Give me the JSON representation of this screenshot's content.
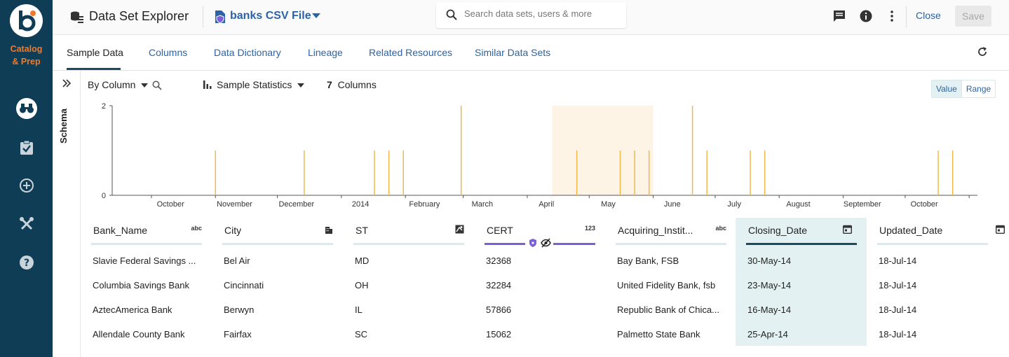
{
  "brand": {
    "logo_letter": "b",
    "product_line1": "Catalog",
    "product_line2": "& Prep",
    "accent": "#f07a2c",
    "sidebar_bg": "#0f3d56"
  },
  "sidebar": {
    "items": [
      {
        "icon": "binoculars-icon",
        "active": true
      },
      {
        "icon": "clipboard-check-icon"
      },
      {
        "icon": "add-circle-icon"
      },
      {
        "icon": "tools-icon"
      },
      {
        "icon": "help-icon"
      }
    ]
  },
  "header": {
    "title": "Data Set Explorer",
    "file_name": "banks CSV File",
    "search_placeholder": "Search data sets, users & more",
    "close_label": "Close",
    "save_label": "Save"
  },
  "tabs": [
    {
      "label": "Sample Data",
      "active": true
    },
    {
      "label": "Columns"
    },
    {
      "label": "Data Dictionary"
    },
    {
      "label": "Lineage"
    },
    {
      "label": "Related Resources"
    },
    {
      "label": "Similar Data Sets"
    }
  ],
  "controls": {
    "by_column": "By Column",
    "stats": "Sample Statistics",
    "column_count": "7",
    "columns_label": "Columns",
    "value_label": "Value",
    "range_label": "Range",
    "schema_label": "Schema"
  },
  "chart_data": {
    "type": "bar",
    "x_tick_labels": [
      "October",
      "November",
      "December",
      "2014",
      "February",
      "March",
      "April",
      "May",
      "June",
      "July",
      "August",
      "September",
      "October"
    ],
    "y_ticks": [
      0,
      2
    ],
    "ylim": [
      0,
      2
    ],
    "bar_color": "#f2b94a",
    "highlight_color": "#fdf4e6",
    "bars": [
      {
        "x": "2013-11-01",
        "y": 1
      },
      {
        "x": "2013-12-14",
        "y": 1
      },
      {
        "x": "2014-01-17",
        "y": 1
      },
      {
        "x": "2014-01-24",
        "y": 1
      },
      {
        "x": "2014-01-31",
        "y": 1
      },
      {
        "x": "2014-02-28",
        "y": 2
      },
      {
        "x": "2014-04-25",
        "y": 1
      },
      {
        "x": "2014-05-16",
        "y": 1
      },
      {
        "x": "2014-05-23",
        "y": 1
      },
      {
        "x": "2014-05-30",
        "y": 1
      },
      {
        "x": "2014-06-20",
        "y": 2
      },
      {
        "x": "2014-06-27",
        "y": 1
      },
      {
        "x": "2014-07-18",
        "y": 1
      },
      {
        "x": "2014-07-25",
        "y": 1
      },
      {
        "x": "2014-10-17",
        "y": 1
      },
      {
        "x": "2014-10-24",
        "y": 1
      }
    ],
    "highlight_range": [
      "2014-04-13",
      "2014-06-01"
    ]
  },
  "table": {
    "columns": [
      {
        "name": "Bank_Name",
        "type": "abc"
      },
      {
        "name": "City",
        "type": "city"
      },
      {
        "name": "ST",
        "type": "map"
      },
      {
        "name": "CERT",
        "type": "123"
      },
      {
        "name": "Acquiring_Instit...",
        "type": "abc"
      },
      {
        "name": "Closing_Date",
        "type": "date"
      },
      {
        "name": "Updated_Date",
        "type": "date"
      }
    ],
    "rows": [
      [
        "Slavie Federal Savings ...",
        "Bel Air",
        "MD",
        "32368",
        "Bay Bank, FSB",
        "30-May-14",
        "18-Jul-14"
      ],
      [
        "Columbia Savings Bank",
        "Cincinnati",
        "OH",
        "32284",
        "United Fidelity Bank, fsb",
        "23-May-14",
        "18-Jul-14"
      ],
      [
        "AztecAmerica Bank",
        "Berwyn",
        "IL",
        "57866",
        "Republic Bank of Chica...",
        "16-May-14",
        "18-Jul-14"
      ],
      [
        "Allendale County Bank",
        "Fairfax",
        "SC",
        "15062",
        "Palmetto State Bank",
        "25-Apr-14",
        "18-Jul-14"
      ]
    ]
  }
}
